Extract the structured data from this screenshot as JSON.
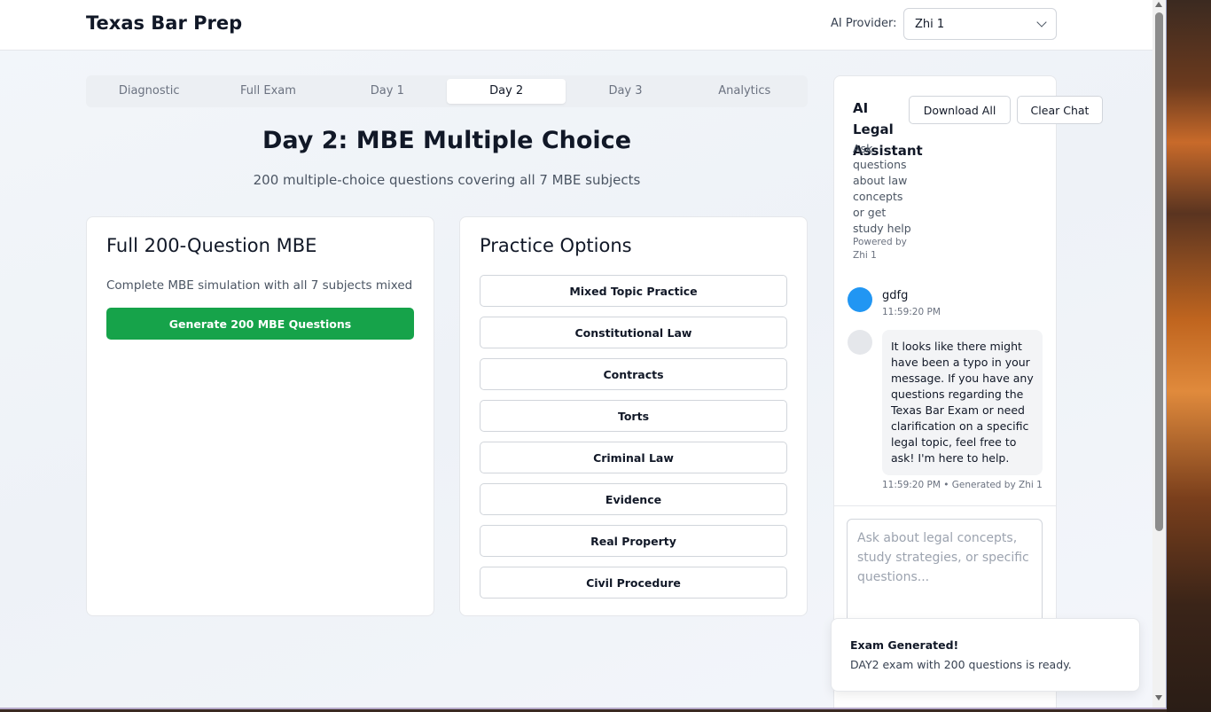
{
  "header": {
    "brand": "Texas Bar Prep",
    "provider_label": "AI Provider:",
    "provider_value": "Zhi 1"
  },
  "tabs": [
    {
      "label": "Diagnostic"
    },
    {
      "label": "Full Exam"
    },
    {
      "label": "Day 1"
    },
    {
      "label": "Day 2",
      "active": true
    },
    {
      "label": "Day 3"
    },
    {
      "label": "Analytics"
    }
  ],
  "main": {
    "title": "Day 2: MBE Multiple Choice",
    "subtitle": "200 multiple-choice questions covering all 7 MBE subjects"
  },
  "full_card": {
    "title": "Full 200-Question MBE",
    "description": "Complete MBE simulation with all 7 subjects mixed",
    "button": "Generate 200 MBE Questions"
  },
  "practice_card": {
    "title": "Practice Options",
    "options": [
      "Mixed Topic Practice",
      "Constitutional Law",
      "Contracts",
      "Torts",
      "Criminal Law",
      "Evidence",
      "Real Property",
      "Civil Procedure"
    ]
  },
  "chat": {
    "title": "AI Legal Assistant",
    "description": "Ask questions about law concepts or get study help",
    "powered_by": "Powered by Zhi 1",
    "download_label": "Download All",
    "clear_label": "Clear Chat",
    "user_message": "gdfg",
    "user_time": "11:59:20 PM",
    "ai_message": "It looks like there might have been a typo in your message. If you have any questions regarding the Texas Bar Exam or need clarification on a specific legal topic, feel free to ask! I'm here to help.",
    "ai_meta": "11:59:20 PM • Generated by Zhi 1",
    "input_placeholder": "Ask about legal concepts, study strategies, or specific questions..."
  },
  "toast": {
    "title": "Exam Generated!",
    "body": "DAY2 exam with 200 questions is ready."
  },
  "colors": {
    "primary_green": "#16a34a",
    "user_avatar": "#2196f3"
  }
}
